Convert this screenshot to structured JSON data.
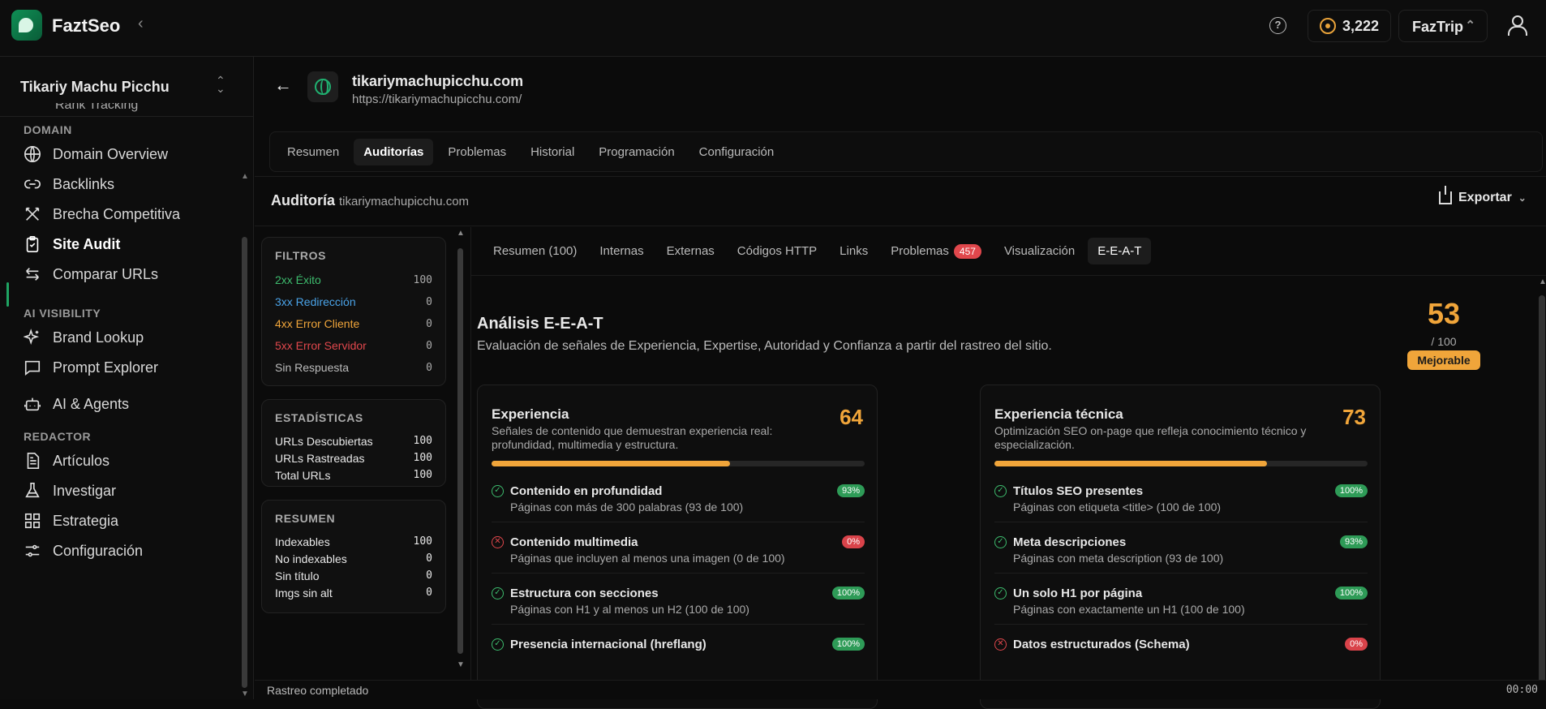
{
  "app": {
    "name": "FaztSeo",
    "credits": "3,222",
    "org": "FazTrip"
  },
  "sidebar": {
    "project": "Tikariy Machu Picchu",
    "cut_item": "Rank Tracking",
    "sections": [
      {
        "title": "DOMAIN",
        "items": [
          {
            "label": "Domain Overview",
            "icon": "globe-icon"
          },
          {
            "label": "Backlinks",
            "icon": "link-icon"
          },
          {
            "label": "Brecha Competitiva",
            "icon": "crossed-swords-icon"
          },
          {
            "label": "Site Audit",
            "icon": "clipboard-check-icon",
            "active": true
          },
          {
            "label": "Comparar URLs",
            "icon": "arrows-compare-icon"
          }
        ]
      },
      {
        "title": "AI VISIBILITY",
        "items": [
          {
            "label": "Brand Lookup",
            "icon": "sparkles-icon"
          },
          {
            "label": "Prompt Explorer",
            "icon": "chat-icon"
          },
          {
            "label": "AI & Agents",
            "icon": "bot-icon"
          }
        ]
      },
      {
        "title": "REDACTOR",
        "items": [
          {
            "label": "Artículos",
            "icon": "document-icon"
          },
          {
            "label": "Investigar",
            "icon": "flask-icon"
          },
          {
            "label": "Estrategia",
            "icon": "grid-icon"
          },
          {
            "label": "Configuración",
            "icon": "sliders-icon"
          }
        ]
      }
    ]
  },
  "site": {
    "domain": "tikariymachupicchu.com",
    "url": "https://tikariymachupicchu.com/"
  },
  "main_tabs": [
    "Resumen",
    "Auditorías",
    "Problemas",
    "Historial",
    "Programación",
    "Configuración"
  ],
  "audit": {
    "title": "Auditoría",
    "domain": "tikariymachupicchu.com",
    "export": "Exportar"
  },
  "filters": {
    "title": "FILTROS",
    "items": [
      {
        "label": "2xx Éxito",
        "value": "100",
        "color": "#3dbb6d"
      },
      {
        "label": "3xx Redirección",
        "value": "0",
        "color": "#4aa3e8"
      },
      {
        "label": "4xx Error Cliente",
        "value": "0",
        "color": "#f0a53a"
      },
      {
        "label": "5xx Error Servidor",
        "value": "0",
        "color": "#e0474c"
      },
      {
        "label": "Sin Respuesta",
        "value": "0",
        "color": "#bbbbbb"
      }
    ]
  },
  "stats": {
    "title": "ESTADÍSTICAS",
    "items": [
      {
        "label": "URLs Descubiertas",
        "value": "100"
      },
      {
        "label": "URLs Rastreadas",
        "value": "100"
      },
      {
        "label": "Total URLs",
        "value": "100"
      }
    ]
  },
  "summary": {
    "title": "RESUMEN",
    "items": [
      {
        "label": "Indexables",
        "value": "100"
      },
      {
        "label": "No indexables",
        "value": "0"
      },
      {
        "label": "Sin título",
        "value": "0"
      },
      {
        "label": "Imgs sin alt",
        "value": "0"
      }
    ]
  },
  "sub_tabs": [
    {
      "label": "Resumen (100)"
    },
    {
      "label": "Internas"
    },
    {
      "label": "Externas"
    },
    {
      "label": "Códigos HTTP"
    },
    {
      "label": "Links"
    },
    {
      "label": "Problemas",
      "badge": "457"
    },
    {
      "label": "Visualización"
    },
    {
      "label": "E-E-A-T",
      "active": true
    }
  ],
  "eeat": {
    "title": "Análisis E-E-A-T",
    "description": "Evaluación de señales de Experiencia, Expertise, Autoridad y Confianza a partir del rastreo del sitio.",
    "score": "53",
    "max": "/ 100",
    "rating": "Mejorable",
    "cards": [
      {
        "title": "Experiencia",
        "score": "64",
        "progress": 0.64,
        "description": "Señales de contenido que demuestran experiencia real: profundidad, multimedia y estructura.",
        "items": [
          {
            "name": "Contenido en profundidad",
            "sub": "Páginas con más de 300 palabras (93 de 100)",
            "pct": "93%",
            "ok": true
          },
          {
            "name": "Contenido multimedia",
            "sub": "Páginas que incluyen al menos una imagen (0 de 100)",
            "pct": "0%",
            "ok": false
          },
          {
            "name": "Estructura con secciones",
            "sub": "Páginas con H1 y al menos un H2 (100 de 100)",
            "pct": "100%",
            "ok": true
          },
          {
            "name": "Presencia internacional (hreflang)",
            "sub": "",
            "pct": "100%",
            "ok": true
          }
        ]
      },
      {
        "title": "Experiencia técnica",
        "score": "73",
        "progress": 0.73,
        "description": "Optimización SEO on-page que refleja conocimiento técnico y especialización.",
        "items": [
          {
            "name": "Títulos SEO presentes",
            "sub": "Páginas con etiqueta <title> (100 de 100)",
            "pct": "100%",
            "ok": true
          },
          {
            "name": "Meta descripciones",
            "sub": "Páginas con meta description (93 de 100)",
            "pct": "93%",
            "ok": true
          },
          {
            "name": "Un solo H1 por página",
            "sub": "Páginas con exactamente un H1 (100 de 100)",
            "pct": "100%",
            "ok": true
          },
          {
            "name": "Datos estructurados (Schema)",
            "sub": "",
            "pct": "0%",
            "ok": false
          }
        ]
      }
    ]
  },
  "status": {
    "left": "Rastreo completado",
    "right": "00:00"
  }
}
